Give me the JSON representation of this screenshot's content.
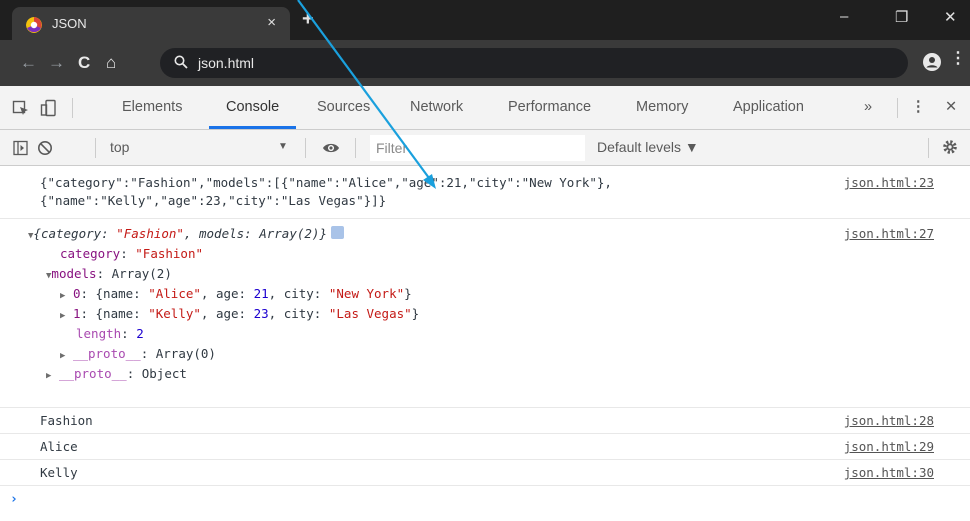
{
  "browser": {
    "tab_title": "JSON",
    "tab_close": "×",
    "new_tab": "+",
    "url": "json.html",
    "window_controls": {
      "minimize": "–",
      "restore": "❐",
      "close": "✕"
    }
  },
  "devtools": {
    "tabs": [
      "Elements",
      "Console",
      "Sources",
      "Network",
      "Performance",
      "Memory",
      "Application"
    ],
    "active_tab": "Console",
    "more": "»",
    "menu": "⋮",
    "close": "✕"
  },
  "console_bar": {
    "context": "top",
    "context_arrow": "▼",
    "filter_placeholder": "Filter",
    "levels": "Default levels ▼"
  },
  "console": {
    "msg1": {
      "line1": "{\"category\":\"Fashion\",\"models\":[{\"name\":\"Alice\",\"age\":21,\"city\":\"New York\"},",
      "line2": "{\"name\":\"Kelly\",\"age\":23,\"city\":\"Las Vegas\"}]}",
      "source": "json.html:23"
    },
    "msg2": {
      "source": "json.html:27",
      "summary_prefix": "{category: ",
      "summary_category": "\"Fashion\"",
      "summary_mid": ", models: ",
      "summary_models": "Array(2)",
      "summary_suffix": "}",
      "category_key": "category",
      "category_value": "\"Fashion\"",
      "models_key": "models",
      "models_value": "Array(2)",
      "item0_key": "0",
      "item0_name": "\"Alice\"",
      "item0_age": "21",
      "item0_city": "\"New York\"",
      "item1_key": "1",
      "item1_name": "\"Kelly\"",
      "item1_age": "23",
      "item1_city": "\"Las Vegas\"",
      "length_key": "length",
      "length_value": "2",
      "proto_key": "__proto__",
      "proto_array": "Array(0)",
      "proto_object": "Object"
    },
    "msg3": {
      "text": "Fashion",
      "source": "json.html:28"
    },
    "msg4": {
      "text": "Alice",
      "source": "json.html:29"
    },
    "msg5": {
      "text": "Kelly",
      "source": "json.html:30"
    },
    "prompt": "›"
  },
  "colors": {
    "accent": "#1a73e8",
    "annotation_arrow": "#1aa0dd",
    "string": "#c41a16",
    "number": "#1c00cf",
    "key": "#881280"
  }
}
